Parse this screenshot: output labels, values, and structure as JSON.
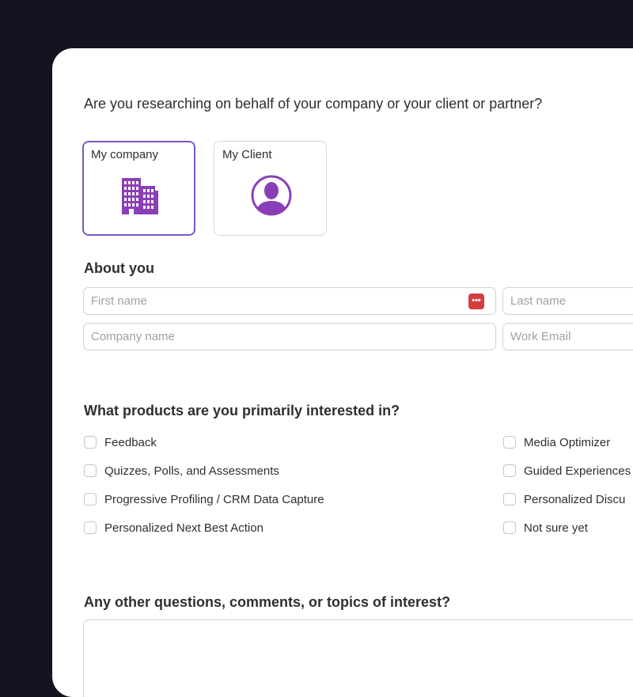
{
  "form": {
    "question": "Are you researching on behalf of your company or your client or partner?",
    "choices": [
      {
        "label": "My company",
        "icon": "building-icon",
        "selected": true
      },
      {
        "label": "My Client",
        "icon": "person-avatar-icon",
        "selected": false
      }
    ],
    "about_title": "About you",
    "fields": {
      "first_name": {
        "placeholder": "First name",
        "value": ""
      },
      "last_name": {
        "placeholder": "Last name",
        "value": ""
      },
      "company_name": {
        "placeholder": "Company name",
        "value": ""
      },
      "work_email": {
        "placeholder": "Work Email",
        "value": ""
      }
    },
    "password_badge": "•••",
    "products_title": "What products are you primarily interested in?",
    "products_left": [
      "Feedback",
      "Quizzes, Polls, and Assessments",
      "Progressive Profiling / CRM Data Capture",
      "Personalized Next Best Action"
    ],
    "products_right": [
      "Media Optimizer",
      "Guided Experiences",
      "Personalized Discu",
      "Not sure yet"
    ],
    "comments_title": "Any other questions, comments, or topics of interest?"
  },
  "colors": {
    "background": "#15131f",
    "accent": "#7a58c8",
    "icon": "#8a3fb8",
    "password_badge": "#d43d3d"
  }
}
